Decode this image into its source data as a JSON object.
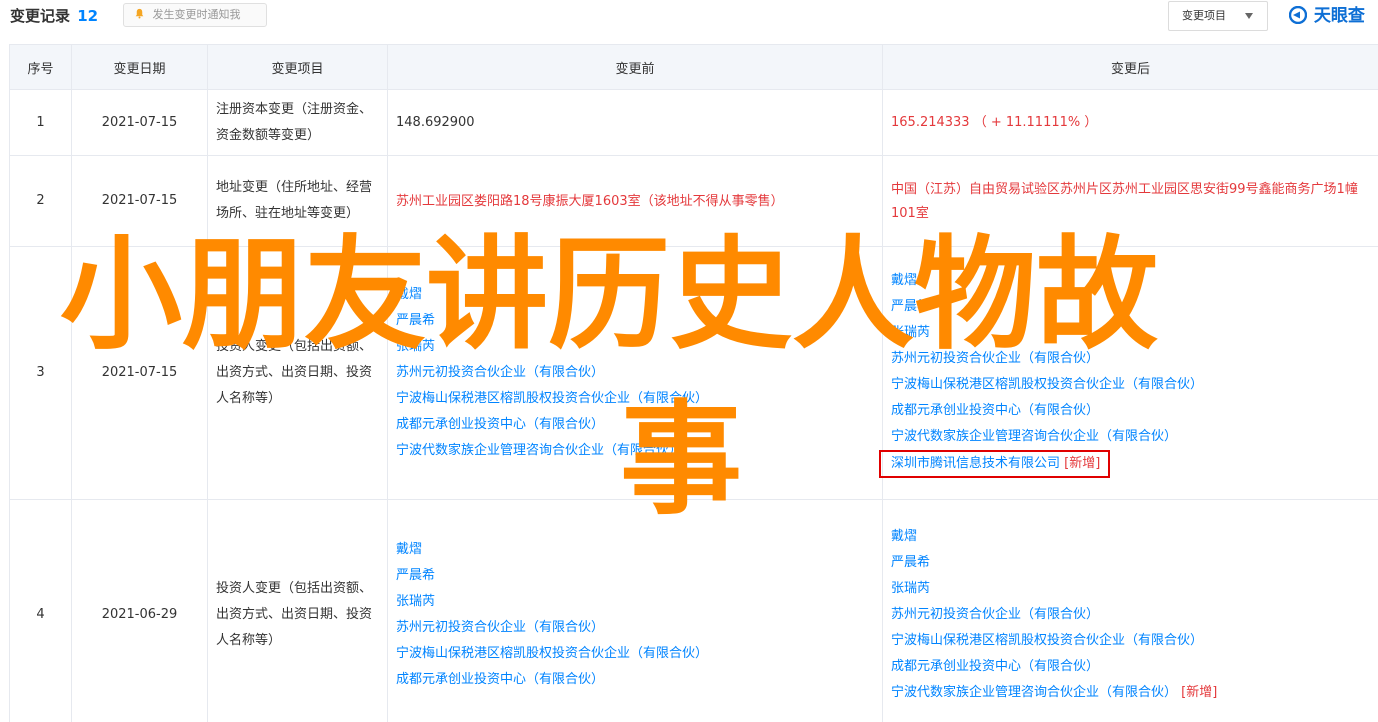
{
  "header": {
    "title": "变更记录",
    "count": "12",
    "notify_label": "发生变更时通知我",
    "filter_label": "变更项目",
    "logo_text": "天眼查"
  },
  "colors": {
    "accent": "#0084ff",
    "highlight_text": "#e4393c",
    "overlay": "#ff8a00",
    "box": "#e00000"
  },
  "icons": {
    "bell": "bell-icon",
    "caret": "caret-down-icon",
    "logo": "tianyancha-logo-icon"
  },
  "table": {
    "headers": [
      "序号",
      "变更日期",
      "变更项目",
      "变更前",
      "变更后"
    ],
    "rows": [
      {
        "no": "1",
        "date": "2021-07-15",
        "item": "注册资本变更（注册资金、资金数额等变更）",
        "before": [
          "148.692900"
        ],
        "after": [
          "165.214333 （ + 11.11111% ）"
        ]
      },
      {
        "no": "2",
        "date": "2021-07-15",
        "item": "地址变更（住所地址、经营场所、驻在地址等变更）",
        "before": [
          "苏州工业园区娄阳路18号康振大厦1603室（该地址不得从事零售）"
        ],
        "after": [
          "中国（江苏）自由贸易试验区苏州片区苏州工业园区思安街99号鑫能商务广场1幢101室"
        ]
      },
      {
        "no": "3",
        "date": "2021-07-15",
        "item": "投资人变更（包括出资额、出资方式、出资日期、投资人名称等）",
        "before": [
          "戴熠",
          "严晨希",
          "张瑞芮",
          "苏州元初投资合伙企业（有限合伙）",
          "宁波梅山保税港区榕凯股权投资合伙企业（有限合伙）",
          "成都元承创业投资中心（有限合伙）",
          "宁波代数家族企业管理咨询合伙企业（有限合伙）"
        ],
        "after": [
          "戴熠",
          "严晨希",
          "张瑞芮",
          "苏州元初投资合伙企业（有限合伙）",
          "宁波梅山保税港区榕凯股权投资合伙企业（有限合伙）",
          "成都元承创业投资中心（有限合伙）",
          "宁波代数家族企业管理咨询合伙企业（有限合伙）"
        ],
        "after_new": "深圳市腾讯信息技术有限公司",
        "new_tag": "[新增]"
      },
      {
        "no": "4",
        "date": "2021-06-29",
        "item": "投资人变更（包括出资额、出资方式、出资日期、投资人名称等）",
        "before": [
          "戴熠",
          "严晨希",
          "张瑞芮",
          "苏州元初投资合伙企业（有限合伙）",
          "宁波梅山保税港区榕凯股权投资合伙企业（有限合伙）",
          "成都元承创业投资中心（有限合伙）"
        ],
        "after": [
          "戴熠",
          "严晨希",
          "张瑞芮",
          "苏州元初投资合伙企业（有限合伙）",
          "宁波梅山保税港区榕凯股权投资合伙企业（有限合伙）",
          "成都元承创业投资中心（有限合伙）"
        ],
        "after_new": "宁波代数家族企业管理咨询合伙企业（有限合伙）",
        "new_tag": "[新增]"
      }
    ]
  },
  "overlay": {
    "line1": "小朋友讲历史人物故",
    "line2": "事"
  }
}
